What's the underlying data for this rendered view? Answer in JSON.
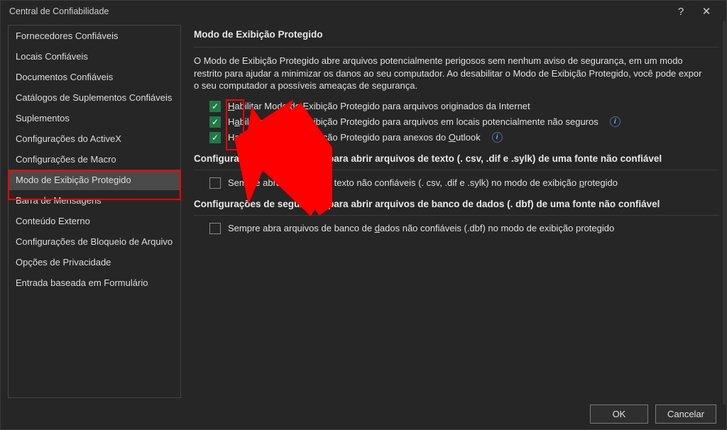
{
  "titlebar": {
    "title": "Central de Confiabilidade"
  },
  "sidebar": {
    "items": [
      {
        "label": "Fornecedores Confiáveis"
      },
      {
        "label": "Locais Confiáveis"
      },
      {
        "label": "Documentos Confiáveis"
      },
      {
        "label": "Catálogos de Suplementos Confiáveis"
      },
      {
        "label": "Suplementos"
      },
      {
        "label": "Configurações do ActiveX"
      },
      {
        "label": "Configurações de Macro"
      },
      {
        "label": "Modo de Exibição Protegido"
      },
      {
        "label": "Barra de Mensagens"
      },
      {
        "label": "Conteúdo Externo"
      },
      {
        "label": "Configurações de Bloqueio de Arquivo"
      },
      {
        "label": "Opções de Privacidade"
      },
      {
        "label": "Entrada baseada em Formulário"
      }
    ],
    "active_index": 7
  },
  "content": {
    "heading": "Modo de Exibição Protegido",
    "description": "O Modo de Exibição Protegido abre arquivos potencialmente perigosos sem nenhum aviso de segurança, em um modo restrito para ajudar a minimizar os danos ao seu computador. Ao desabilitar o Modo de Exibição Protegido, você pode expor o seu computador a possíveis ameaças de segurança.",
    "options": [
      {
        "checked": true,
        "pre": "",
        "accel": "H",
        "post": "abilitar Modo de Exibição Protegido para arquivos originados da Internet",
        "info": false
      },
      {
        "checked": true,
        "pre": "H",
        "accel": "a",
        "post": "bilitar Modo de Exibição Protegido para arquivos em locais potencialmente não seguros",
        "info": true
      },
      {
        "checked": true,
        "pre": "Habilitar Modo de Exibição Protegido para anexos do ",
        "accel": "O",
        "post": "utlook",
        "info": true
      }
    ],
    "text_section": {
      "heading": "Configurações de segurança para abrir arquivos de texto (. csv, .dif e .sylk) de uma fonte não confiável",
      "option": {
        "checked": false,
        "pre": "Sempre abra arquivos de texto não confiáveis (. csv, .dif e .sylk) no modo de exibição ",
        "accel": "p",
        "post": "rotegido"
      }
    },
    "db_section": {
      "heading": "Configurações de segurança para abrir arquivos de banco de dados (. dbf) de uma fonte não confiável",
      "option": {
        "checked": false,
        "pre": "Sempre abra arquivos de banco de ",
        "accel": "d",
        "post": "ados não confiáveis (.dbf) no modo de exibição protegido"
      }
    }
  },
  "footer": {
    "ok": "OK",
    "cancel": "Cancelar"
  }
}
